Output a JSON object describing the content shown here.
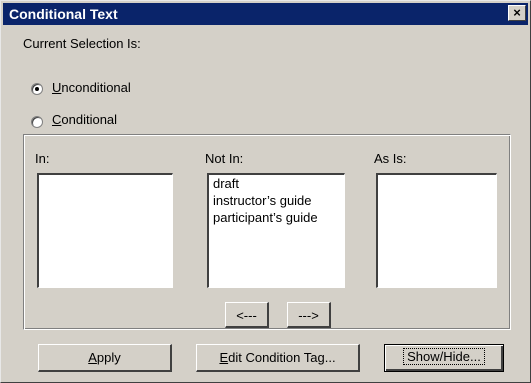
{
  "title": "Conditional Text",
  "close_glyph": "×",
  "current_selection_label": "Current Selection Is:",
  "radios": {
    "unconditional": {
      "access_key": "U",
      "rest": "nconditional",
      "selected": true
    },
    "conditional": {
      "access_key": "C",
      "rest": "onditional",
      "selected": false
    }
  },
  "lists": {
    "in": {
      "label": "In:",
      "items": []
    },
    "not_in": {
      "label": "Not In:",
      "items": [
        "draft",
        "instructor’s guide",
        "participant’s guide"
      ]
    },
    "as_is": {
      "label": "As Is:",
      "items": []
    }
  },
  "move_buttons": {
    "left": "<---",
    "right": "--->"
  },
  "buttons": {
    "apply": {
      "access_key": "A",
      "rest": "pply"
    },
    "edit_condition_tag": {
      "access_key": "E",
      "rest": "dit Condition Tag..."
    },
    "show_hide": {
      "label": "Show/Hide..."
    }
  }
}
